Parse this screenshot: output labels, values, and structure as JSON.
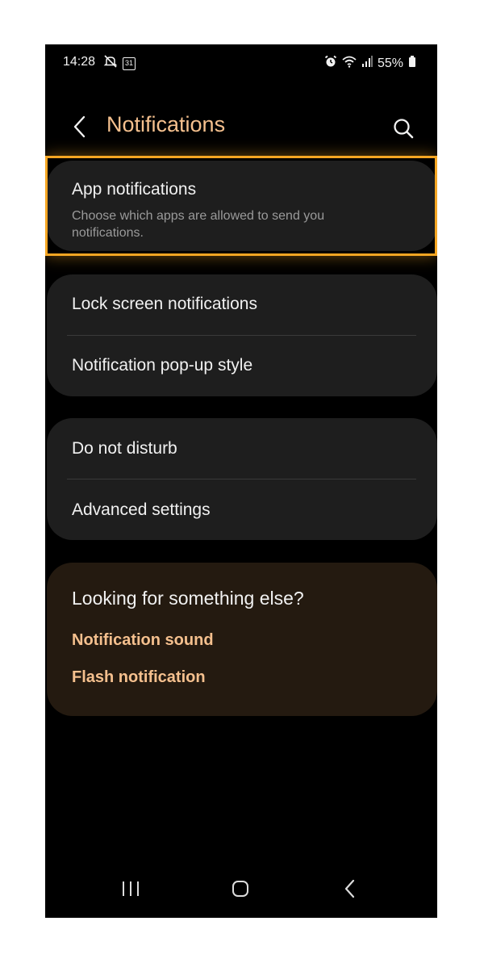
{
  "status_bar": {
    "time": "14:28",
    "calendar_day": "31",
    "battery": "55%",
    "icons_left": [
      "mute-icon",
      "calendar-icon"
    ],
    "icons_right": [
      "alarm-icon",
      "wifi-icon",
      "signal-icon",
      "battery-icon"
    ]
  },
  "header": {
    "title": "Notifications",
    "back_icon": "back-chevron-icon",
    "search_icon": "search-icon"
  },
  "groups": [
    {
      "items": [
        {
          "title": "App notifications",
          "subtitle": "Choose which apps are allowed to send you notifications."
        }
      ]
    },
    {
      "items": [
        {
          "title": "Lock screen notifications"
        },
        {
          "title": "Notification pop-up style"
        }
      ]
    },
    {
      "items": [
        {
          "title": "Do not disturb"
        },
        {
          "title": "Advanced settings"
        }
      ]
    }
  ],
  "suggestions": {
    "title": "Looking for something else?",
    "links": [
      "Notification sound",
      "Flash notification"
    ]
  },
  "nav_bar": {
    "icons": [
      "recents-icon",
      "home-icon",
      "back-icon"
    ]
  },
  "colors": {
    "accent": "#f5c08e",
    "highlight": "#f5a623",
    "card": "#1e1e1e",
    "suggest_card": "#241a10",
    "background": "#000000"
  }
}
